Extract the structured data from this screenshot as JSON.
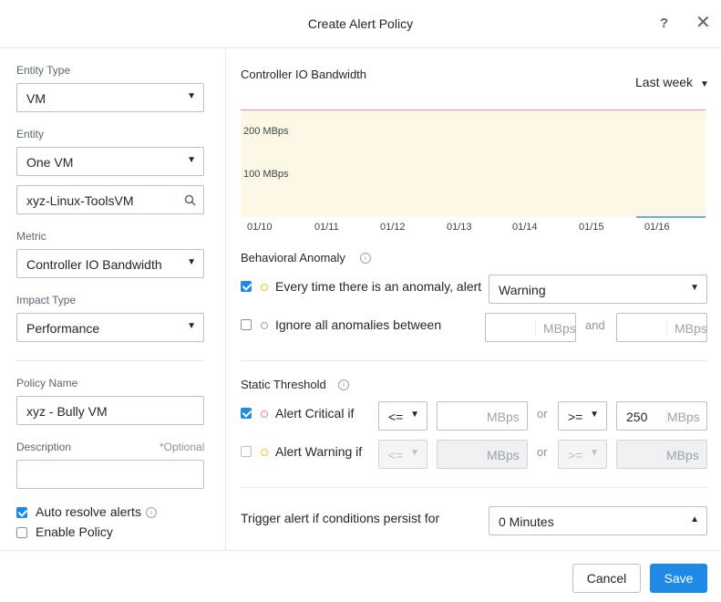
{
  "dialog": {
    "title": "Create Alert Policy",
    "help_icon": "?",
    "close_icon": "✕"
  },
  "left": {
    "entity_type": {
      "label": "Entity Type",
      "value": "VM"
    },
    "entity": {
      "label": "Entity",
      "value": "One VM",
      "search_value": "xyz-Linux-ToolsVM"
    },
    "metric": {
      "label": "Metric",
      "value": "Controller IO Bandwidth"
    },
    "impact_type": {
      "label": "Impact Type",
      "value": "Performance"
    },
    "policy_name": {
      "label": "Policy Name",
      "value": "xyz - Bully VM"
    },
    "description": {
      "label": "Description",
      "optional": "*Optional",
      "value": ""
    },
    "auto_resolve": {
      "label": "Auto resolve alerts",
      "checked": true
    },
    "enable_policy": {
      "label": "Enable Policy",
      "checked": false
    }
  },
  "chart": {
    "title": "Controller IO Bandwidth",
    "range_label": "Last week",
    "y_ticks": [
      "200 MBps",
      "100 MBps"
    ],
    "x_ticks": [
      "01/10",
      "01/11",
      "01/12",
      "01/13",
      "01/14",
      "01/15",
      "01/16"
    ]
  },
  "behavioral": {
    "title": "Behavioral Anomaly",
    "row1": {
      "label": "Every time there is an anomaly, alert",
      "checked": true,
      "severity": "Warning"
    },
    "row2": {
      "label": "Ignore all anomalies between",
      "checked": false,
      "unit": "MBps",
      "and": "and"
    }
  },
  "static": {
    "title": "Static Threshold",
    "critical": {
      "label": "Alert Critical if",
      "checked": true,
      "op1": "<=",
      "unit": "MBps",
      "or": "or",
      "op2": ">=",
      "value2": "250"
    },
    "warning": {
      "label": "Alert Warning if",
      "checked": false,
      "op1": "<=",
      "unit": "MBps",
      "or": "or",
      "op2": ">="
    }
  },
  "trigger": {
    "label": "Trigger alert if conditions persist for",
    "value": "0 Minutes"
  },
  "footer": {
    "cancel": "Cancel",
    "save": "Save"
  },
  "colors": {
    "accent": "#1f8ae6",
    "critical": "#f28d8d",
    "warning": "#f2c230",
    "chart_bg": "#fdf8e6"
  }
}
